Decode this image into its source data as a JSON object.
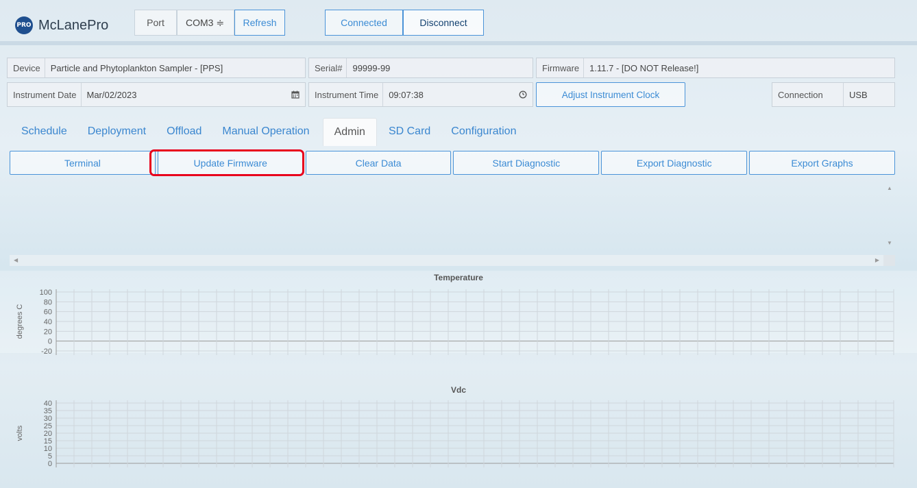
{
  "app": {
    "logo_badge": "PRO",
    "name": "McLanePro"
  },
  "port": {
    "label": "Port",
    "value": "COM3 ≑",
    "refresh": "Refresh"
  },
  "connection_buttons": {
    "connected": "Connected",
    "disconnect": "Disconnect"
  },
  "info1": {
    "device_label": "Device",
    "device_value": "Particle and Phytoplankton Sampler - [PPS]",
    "serial_label": "Serial#",
    "serial_value": "99999-99",
    "firmware_label": "Firmware",
    "firmware_value": "1.11.7 - [DO NOT Release!]"
  },
  "info2": {
    "date_label": "Instrument Date",
    "date_value": "Mar/02/2023",
    "time_label": "Instrument Time",
    "time_value": "09:07:38",
    "adjust_clock": "Adjust Instrument Clock",
    "conn_label": "Connection",
    "conn_value": "USB"
  },
  "tabs": [
    "Schedule",
    "Deployment",
    "Offload",
    "Manual Operation",
    "Admin",
    "SD Card",
    "Configuration"
  ],
  "active_tab": "Admin",
  "actions": [
    "Terminal",
    "Update Firmware",
    "Clear Data",
    "Start Diagnostic",
    "Export Diagnostic",
    "Export Graphs"
  ],
  "highlighted_action": "Update Firmware",
  "icons": {
    "calendar": "calendar-icon",
    "clock": "clock-icon"
  },
  "colors": {
    "accent": "#3b8bd4",
    "highlight": "#e8001c",
    "logo": "#1f4f8f"
  },
  "chart_data": [
    {
      "type": "line",
      "title": "Temperature",
      "ylabel": "degrees C",
      "yticks": [
        100,
        80,
        60,
        40,
        20,
        0,
        -20
      ],
      "ylim": [
        -20,
        100
      ],
      "series": [],
      "grid": true
    },
    {
      "type": "line",
      "title": "Vdc",
      "ylabel": "volts",
      "yticks": [
        40,
        35,
        30,
        25,
        20,
        15,
        10,
        5,
        0
      ],
      "ylim": [
        0,
        40
      ],
      "series": [],
      "grid": true
    }
  ]
}
